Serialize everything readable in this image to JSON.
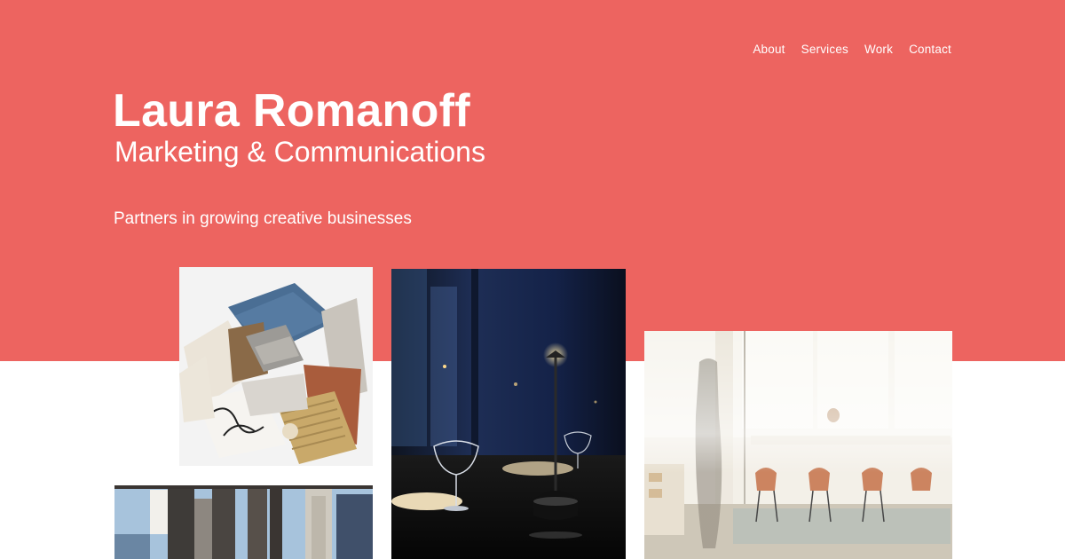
{
  "colors": {
    "hero_background": "#ed6460",
    "text": "#ffffff",
    "page_background": "#ffffff"
  },
  "nav": {
    "items": [
      "About",
      "Services",
      "Work",
      "Contact"
    ]
  },
  "hero": {
    "name": "Laura Romanoff",
    "subtitle": "Marketing & Communications",
    "tagline": "Partners in growing creative businesses"
  },
  "images": [
    {
      "name": "materials-samples-photo",
      "subject": "fabric, stone and wood material samples"
    },
    {
      "name": "restaurant-photo",
      "subject": "restaurant table with wine glasses and lamp"
    },
    {
      "name": "office-photo",
      "subject": "glass-walled meeting room"
    },
    {
      "name": "architecture-photo",
      "subject": "city building facade"
    }
  ]
}
